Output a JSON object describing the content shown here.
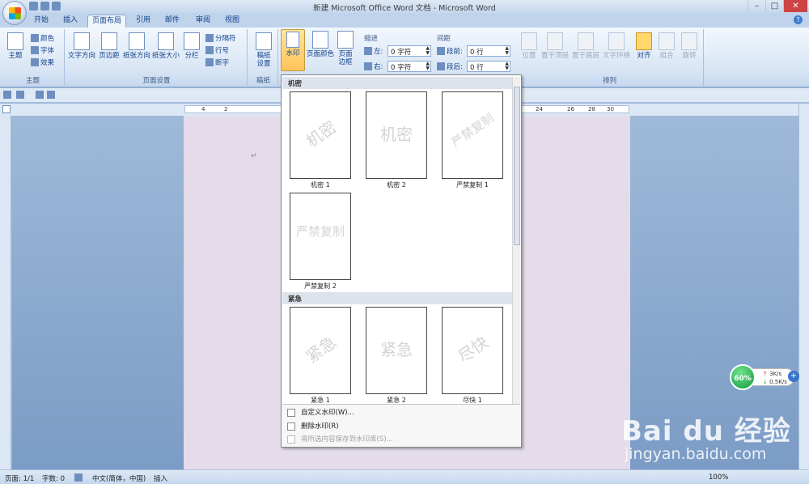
{
  "window": {
    "title": "新建 Microsoft Office Word 文档 - Microsoft Word"
  },
  "tabs": [
    {
      "label": "开始",
      "active": false
    },
    {
      "label": "插入",
      "active": false
    },
    {
      "label": "页面布局",
      "active": true
    },
    {
      "label": "引用",
      "active": false
    },
    {
      "label": "邮件",
      "active": false
    },
    {
      "label": "审阅",
      "active": false
    },
    {
      "label": "视图",
      "active": false
    }
  ],
  "ribbon": {
    "theme_group": {
      "label": "主题",
      "themes": "主题",
      "colors": "颜色",
      "fonts": "字体",
      "effects": "效果"
    },
    "page_setup_group": {
      "label": "页面设置",
      "text_direction": "文字方向",
      "margins": "页边距",
      "orientation": "纸张方向",
      "size": "纸张大小",
      "columns": "分栏",
      "breaks": "分隔符",
      "line_numbers": "行号",
      "hyphenation": "断字"
    },
    "draft_group": {
      "label": "稿纸",
      "draft_settings": "稿纸\n设置"
    },
    "page_bg_group": {
      "watermark": "水印",
      "page_color": "页面颜色",
      "page_borders": "页面\n边框"
    },
    "paragraph_group": {
      "indent_label": "缩进",
      "left_label": "左:",
      "left_value": "0 字符",
      "right_label": "右:",
      "right_value": "0 字符",
      "spacing_label": "间距",
      "before_label": "段前:",
      "before_value": "0 行",
      "after_label": "段后:",
      "after_value": "0 行"
    },
    "arrange_group": {
      "label": "排列",
      "position": "位置",
      "bring_front": "置于顶层",
      "send_back": "置于底层",
      "text_wrap": "文字环绕",
      "align": "对齐",
      "group": "组合",
      "rotate": "旋转"
    }
  },
  "ruler": {
    "numbers": [
      "4",
      "2",
      "24",
      "26",
      "28",
      "30"
    ]
  },
  "watermark_gallery": {
    "sections": [
      {
        "title": "机密",
        "items": [
          {
            "label": "机密 1",
            "text": "机密",
            "style": "diagonal"
          },
          {
            "label": "机密 2",
            "text": "机密",
            "style": "horizontal"
          },
          {
            "label": "严禁复制 1",
            "text": "严禁复制",
            "style": "diagonal"
          },
          {
            "label": "严禁复制 2",
            "text": "严禁复制",
            "style": "horizontal"
          }
        ]
      },
      {
        "title": "紧急",
        "items": [
          {
            "label": "紧急 1",
            "text": "紧急",
            "style": "diagonal"
          },
          {
            "label": "紧急 2",
            "text": "紧急",
            "style": "horizontal"
          },
          {
            "label": "尽快 1",
            "text": "尽快",
            "style": "diagonal"
          }
        ]
      }
    ],
    "menu": {
      "custom": "自定义水印(W)...",
      "remove": "删除水印(R)",
      "save": "将所选内容保存到水印库(S)..."
    }
  },
  "status": {
    "page": "页面: 1/1",
    "words": "字数: 0",
    "language": "中文(简体，中国)",
    "mode": "插入",
    "zoom": "100%"
  },
  "net_monitor": {
    "percent": "60%",
    "up": "3K/s",
    "down": "0.5K/s"
  },
  "baidu_watermark": {
    "logo": "Bai du 经验",
    "url": "jingyan.baidu.com"
  }
}
